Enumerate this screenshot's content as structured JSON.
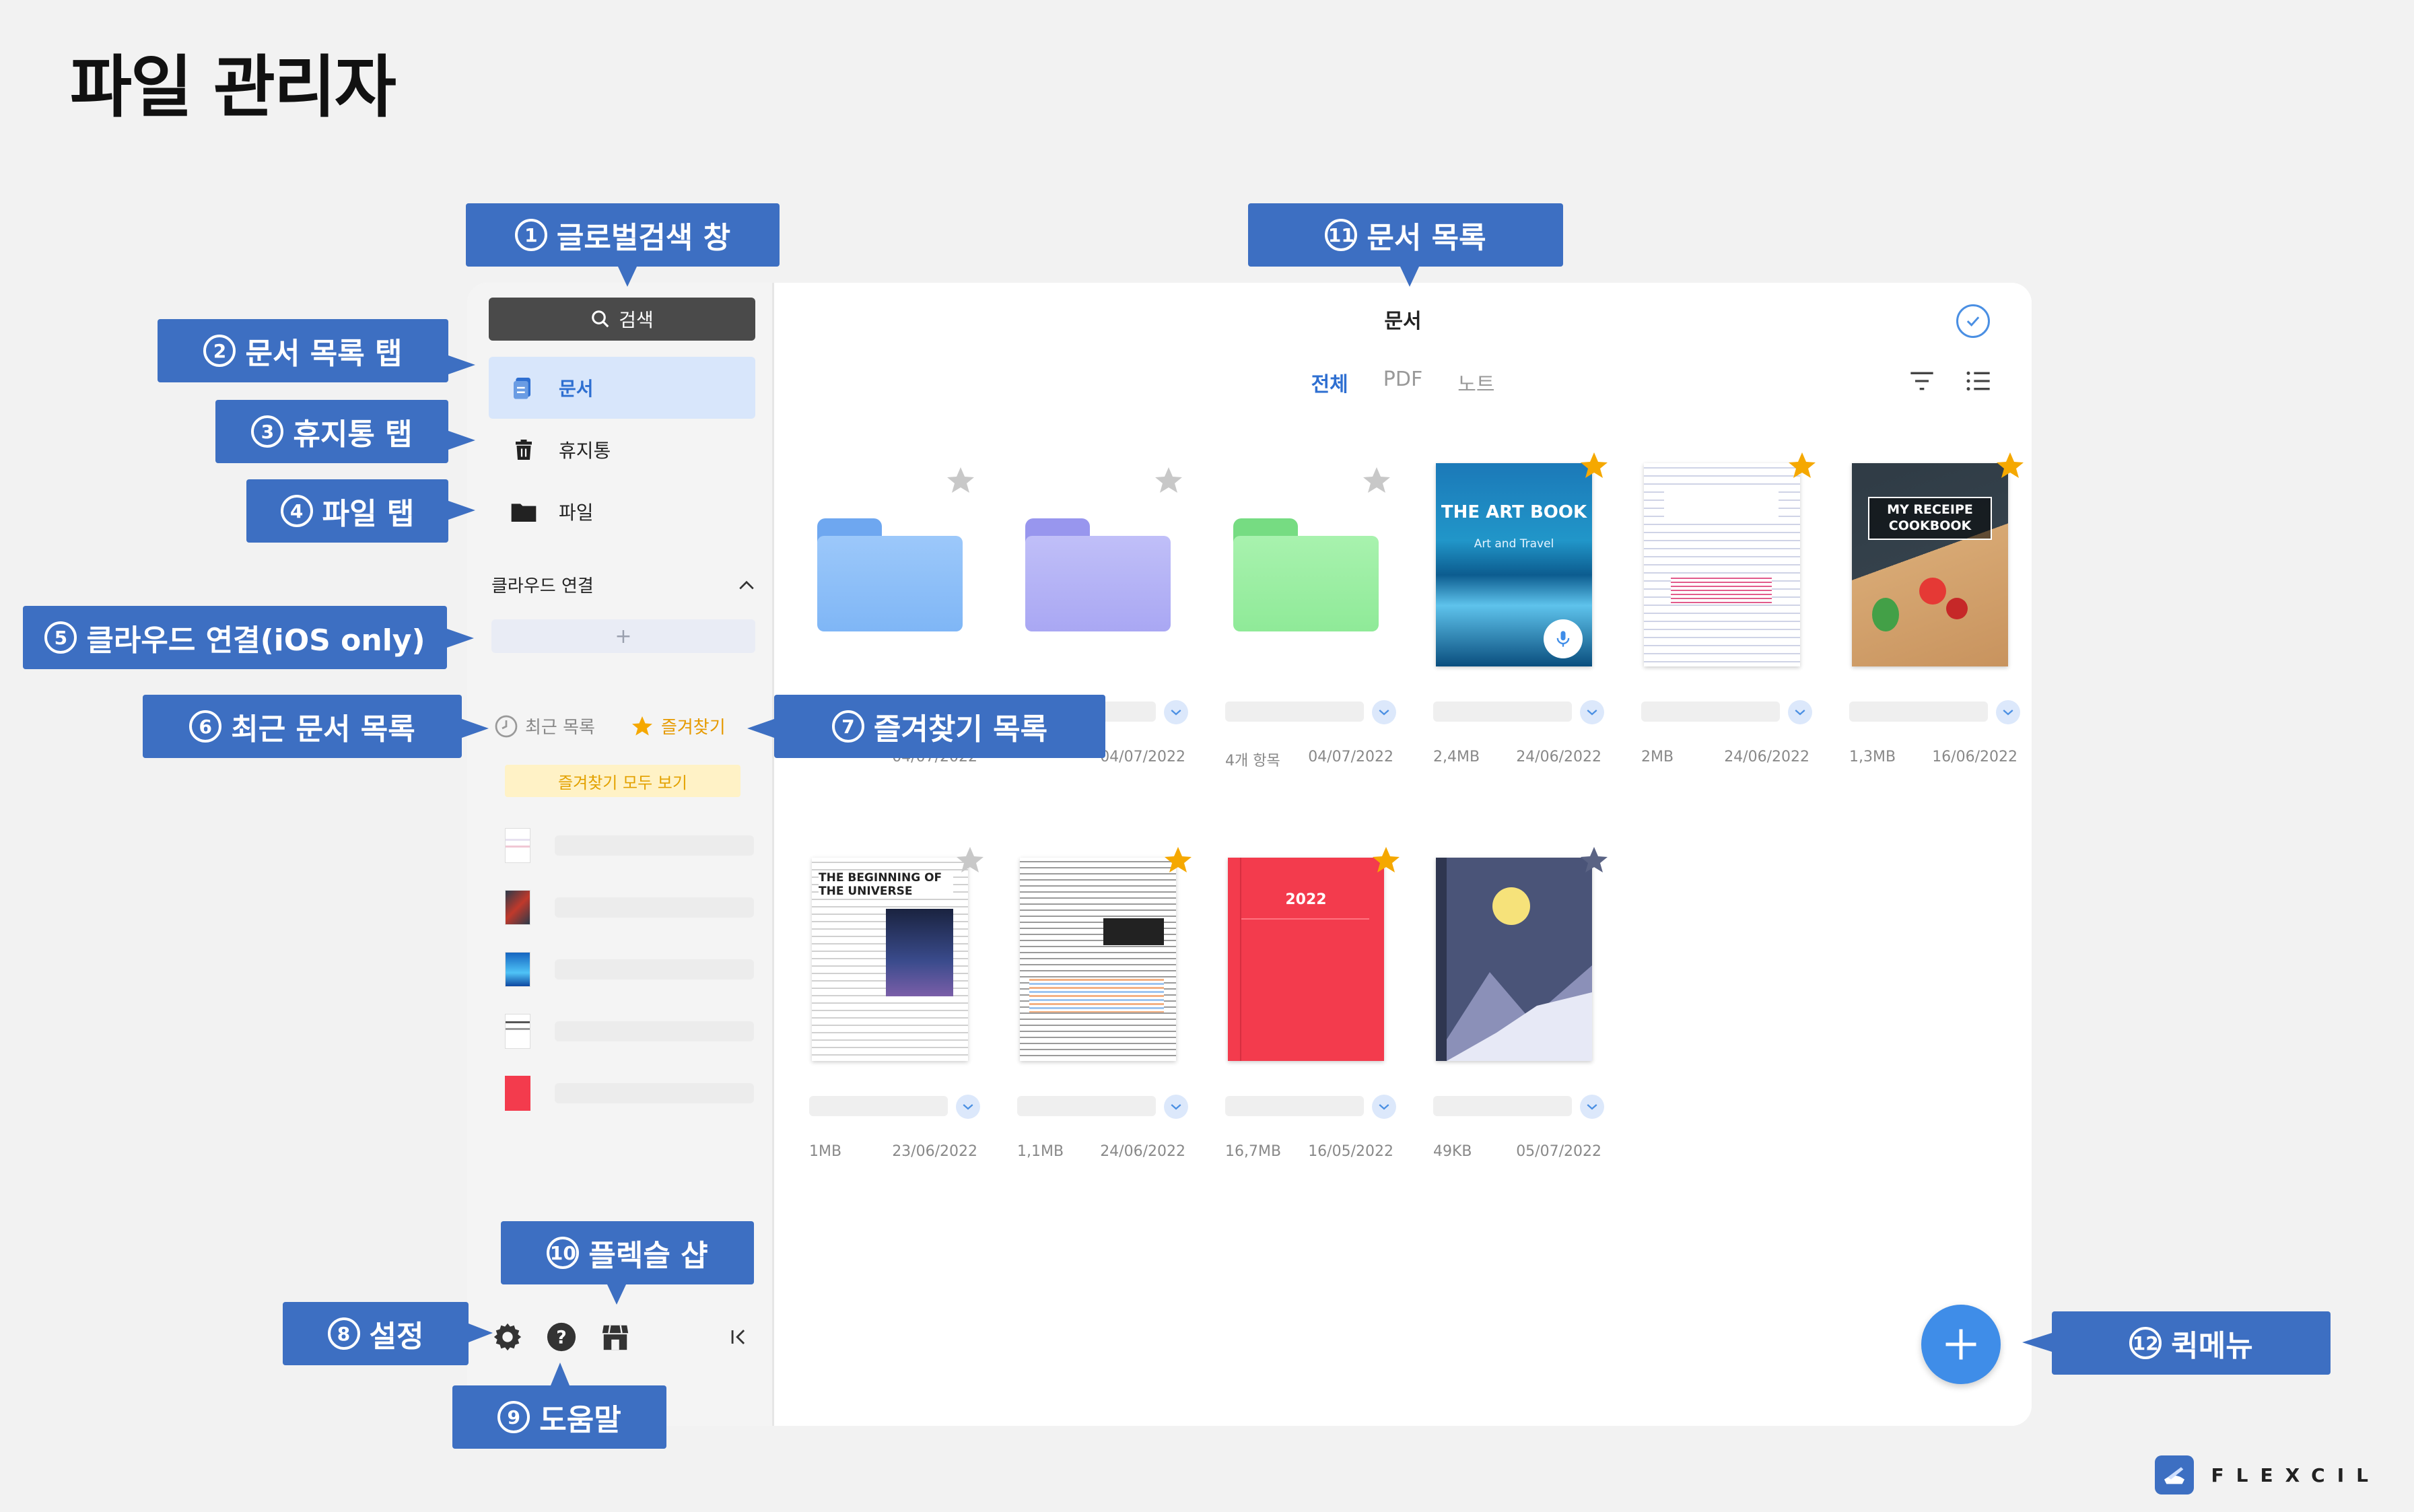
{
  "page_title": "파일 관리자",
  "callouts": {
    "c1": {
      "num": "1",
      "label": "글로벌검색 창"
    },
    "c2": {
      "num": "2",
      "label": "문서 목록 탭"
    },
    "c3": {
      "num": "3",
      "label": "휴지통 탭"
    },
    "c4": {
      "num": "4",
      "label": "파일 탭"
    },
    "c5": {
      "num": "5",
      "label": "클라우드 연결(iOS only)"
    },
    "c6": {
      "num": "6",
      "label": "최근 문서 목록"
    },
    "c7": {
      "num": "7",
      "label": "즐겨찾기 목록"
    },
    "c8": {
      "num": "8",
      "label": "설정"
    },
    "c9": {
      "num": "9",
      "label": "도움말"
    },
    "c10": {
      "num": "10",
      "label": "플렉슬 샵"
    },
    "c11": {
      "num": "11",
      "label": "문서 목록"
    },
    "c12": {
      "num": "12",
      "label": "퀵메뉴"
    }
  },
  "sidebar": {
    "search_label": "검색",
    "nav": [
      {
        "label": "문서",
        "icon": "document-icon"
      },
      {
        "label": "휴지통",
        "icon": "trash-icon"
      },
      {
        "label": "파일",
        "icon": "folder-icon"
      }
    ],
    "cloud_label": "클라우드 연결",
    "cloud_add": "+",
    "recent_label": "최근 목록",
    "favorites_label": "즐겨찾기",
    "favorites_all": "즐겨찾기 모두 보기"
  },
  "main": {
    "title": "문서",
    "tabs": [
      "전체",
      "PDF",
      "노트"
    ]
  },
  "items": [
    {
      "type": "folder",
      "color": "#7fb6f6",
      "fav": false,
      "size": "",
      "date": "04/07/2022"
    },
    {
      "type": "folder",
      "color": "#a9a7f3",
      "fav": false,
      "size": "",
      "date": "04/07/2022"
    },
    {
      "type": "folder",
      "color": "#8fea98",
      "fav": false,
      "size": "4개 항목",
      "date": "04/07/2022"
    },
    {
      "type": "artbook",
      "fav": true,
      "cover_title": "THE ART BOOK",
      "cover_sub": "Art and Travel",
      "size": "2,4MB",
      "date": "24/06/2022"
    },
    {
      "type": "paper",
      "fav": true,
      "size": "2MB",
      "date": "24/06/2022"
    },
    {
      "type": "cookbook",
      "fav": true,
      "cover_title": "MY RECEIPE COOKBOOK",
      "size": "1,3MB",
      "date": "16/06/2022"
    },
    {
      "type": "universe",
      "fav": false,
      "cover_title": "THE BEGINNING OF THE UNIVERSE",
      "size": "1MB",
      "date": "23/06/2022"
    },
    {
      "type": "paper2",
      "fav": true,
      "size": "1,1MB",
      "date": "24/06/2022"
    },
    {
      "type": "notebook",
      "fav": true,
      "cover_title": "2022",
      "size": "16,7MB",
      "date": "16/05/2022"
    },
    {
      "type": "landscape",
      "fav": false,
      "size": "49KB",
      "date": "05/07/2022"
    }
  ],
  "brand": "FLEXCIL",
  "colors": {
    "accent": "#3d6fc2",
    "fav": "#f5a800",
    "fab": "#3f8de8"
  }
}
